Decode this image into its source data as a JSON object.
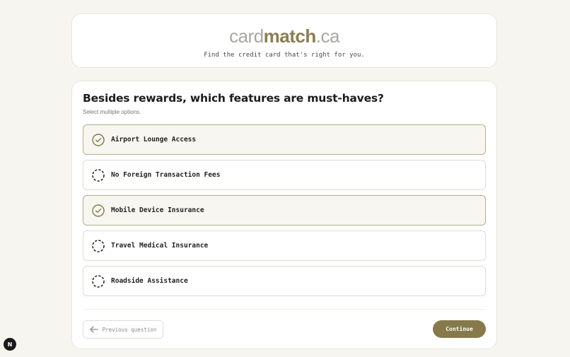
{
  "header": {
    "logo_part1": "card",
    "logo_part2": "match",
    "logo_part3": ".ca",
    "tagline": "Find the credit card that's right for you."
  },
  "question": {
    "title": "Besides rewards, which features are must-haves?",
    "subtitle": "Select multiple options.",
    "options": [
      {
        "label": "Airport Lounge Access",
        "selected": true
      },
      {
        "label": "No Foreign Transaction Fees",
        "selected": false
      },
      {
        "label": "Mobile Device Insurance",
        "selected": true
      },
      {
        "label": "Travel Medical Insurance",
        "selected": false
      },
      {
        "label": "Roadside Assistance",
        "selected": false
      }
    ]
  },
  "nav": {
    "previous_label": "Previous question",
    "continue_label": "Continue"
  },
  "dev_badge": {
    "label": "N"
  },
  "colors": {
    "accent": "#867a4c",
    "accent_light": "#f7f6f0",
    "background": "#f6f5f0"
  }
}
